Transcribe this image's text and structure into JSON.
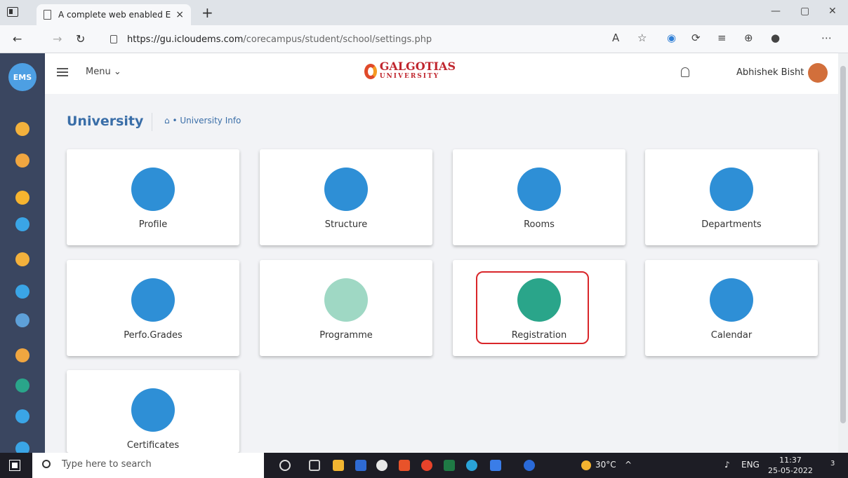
{
  "browser": {
    "tab_title": "A complete web enabled Educat",
    "tab_close": "×",
    "new_tab": "+",
    "url_host": "https://gu.icloudems.com",
    "url_path": "/corecampus/student/school/settings.php"
  },
  "header": {
    "menu_label": "Menu ⌄",
    "logo_name": "GALGOTIAS",
    "logo_sub": "UNIVERSITY",
    "user_name": "Abhishek Bisht"
  },
  "page": {
    "title": "University",
    "breadcrumb": "University Info"
  },
  "cards": [
    {
      "label": "Profile",
      "icon": "building-icon",
      "color": "#2e8fd6"
    },
    {
      "label": "Structure",
      "icon": "hierarchy-icon",
      "color": "#2e8fd6"
    },
    {
      "label": "Rooms",
      "icon": "classroom-icon",
      "color": "#2e8fd6"
    },
    {
      "label": "Departments",
      "icon": "departments-icon",
      "color": "#2e8fd6"
    },
    {
      "label": "Perfo.Grades",
      "icon": "bar-chart-icon",
      "color": "#2e8fd6"
    },
    {
      "label": "Programme",
      "icon": "book-icon",
      "color": "#9fd8c4"
    },
    {
      "label": "Registration",
      "icon": "clipboard-icon",
      "color": "#2aa58a"
    },
    {
      "label": "Calendar",
      "icon": "calendar-icon",
      "color": "#2e8fd6"
    },
    {
      "label": "Certificates",
      "icon": "certificate-icon",
      "color": "#2e8fd6"
    }
  ],
  "taskbar": {
    "search_placeholder": "Type here to search",
    "weather": "30°C",
    "language": "ENG",
    "time": "11:37",
    "date": "25-05-2022",
    "notification_count": "3"
  },
  "colors": {
    "accent": "#3a6ea8",
    "rail": "#3a4660",
    "highlight": "#d9262a"
  }
}
